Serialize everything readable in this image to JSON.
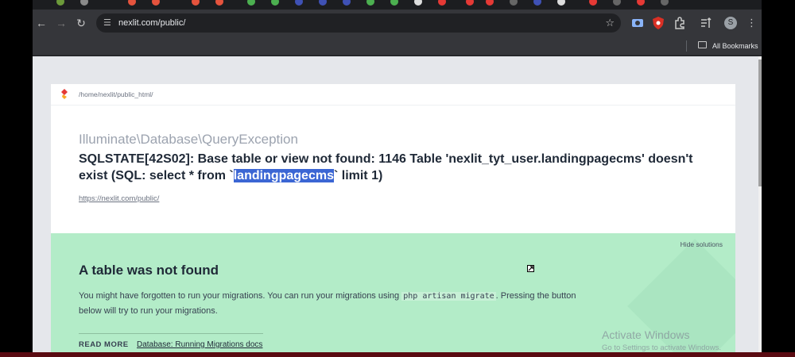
{
  "browser": {
    "url": "nexlit.com/public/",
    "bookmarks_label": "All Bookmarks",
    "profile_initial": "S",
    "accent_colors": [
      "#e53935",
      "#43a047",
      "#1e88e5",
      "#fb8c00",
      "#8e24aa",
      "#fdd835",
      "#00acc1"
    ]
  },
  "page": {
    "path": "/home/nexlit/public_html/",
    "exception_class": "Illuminate\\Database\\QueryException",
    "message_before": "SQLSTATE[42S02]: Base table or view not found: 1146 Table 'nexlit_tyt_user.landingpagecms' doesn't exist (SQL: select * from `",
    "message_highlight": "landingpagecms",
    "message_after": "` limit 1)",
    "request_url": "https://nexlit.com/public/"
  },
  "solution": {
    "hide_label": "Hide solutions",
    "title": "A table was not found",
    "body_before": "You might have forgotten to run your migrations. You can run your migrations using ",
    "command": "php artisan migrate",
    "body_after": ". Pressing the button below will try to run your migrations.",
    "read_more_label": "READ MORE",
    "docs_link_label": "Database: Running Migrations docs"
  },
  "watermark": {
    "line1": "Activate Windows",
    "line2": "Go to Settings to activate Windows."
  }
}
